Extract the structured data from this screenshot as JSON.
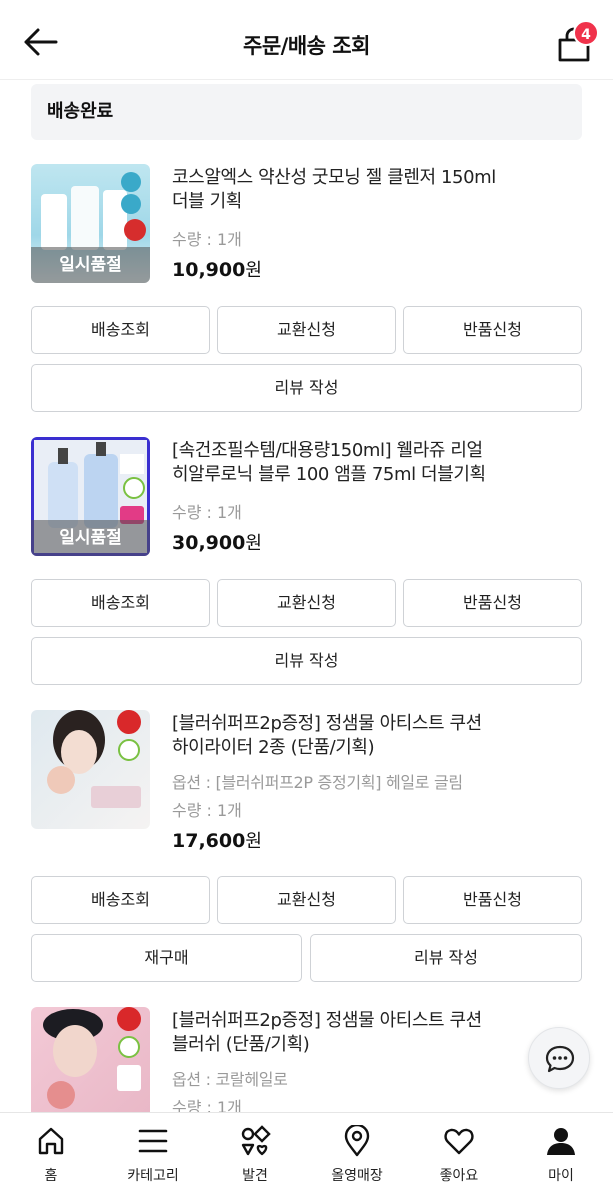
{
  "header": {
    "title": "주문/배송 조회",
    "cart_count": "4"
  },
  "status": {
    "label": "배송완료"
  },
  "items": [
    {
      "title_line1": "코스알엑스 약산성 굿모닝 젤 클렌저 150ml",
      "title_line2": "더블 기획",
      "option": "",
      "quantity": "수량 : 1개",
      "price": "10,900",
      "currency": "원",
      "thumb_overlay": "일시품절",
      "buttons": [
        "배송조회",
        "교환신청",
        "반품신청",
        "리뷰 작성"
      ]
    },
    {
      "title_line1": "[속건조필수템/대용량150ml] 웰라쥬 리얼",
      "title_line2": "히알루로닉 블루 100 앰플 75ml 더블기획",
      "option": "",
      "quantity": "수량 : 1개",
      "price": "30,900",
      "currency": "원",
      "thumb_overlay": "일시품절",
      "buttons": [
        "배송조회",
        "교환신청",
        "반품신청",
        "리뷰 작성"
      ]
    },
    {
      "title_line1": "[블러쉬퍼프2p증정] 정샘물 아티스트 쿠션",
      "title_line2": "하이라이터 2종 (단품/기획)",
      "option": "옵션 : [블러쉬퍼프2P 증정기획] 헤일로 글림",
      "quantity": "수량 : 1개",
      "price": "17,600",
      "currency": "원",
      "thumb_overlay": "",
      "buttons": [
        "배송조회",
        "교환신청",
        "반품신청",
        "재구매",
        "리뷰 작성"
      ]
    },
    {
      "title_line1": "[블러쉬퍼프2p증정] 정샘물 아티스트 쿠션",
      "title_line2": "블러쉬 (단품/기획)",
      "option": "옵션 : 코랄헤일로",
      "quantity": "수량 : 1개",
      "price": "",
      "currency": "",
      "thumb_overlay": "",
      "buttons": []
    }
  ],
  "bottom_nav": [
    {
      "label": "홈",
      "icon": "home-icon"
    },
    {
      "label": "카테고리",
      "icon": "menu-icon"
    },
    {
      "label": "발견",
      "icon": "discover-icon"
    },
    {
      "label": "올영매장",
      "icon": "location-pin-icon"
    },
    {
      "label": "좋아요",
      "icon": "heart-icon"
    },
    {
      "label": "마이",
      "icon": "user-icon"
    }
  ],
  "colors": {
    "badge": "#f0324b",
    "border": "#cfd2d6",
    "muted_text": "#9a9a9a",
    "banner_bg": "#f3f4f6"
  }
}
